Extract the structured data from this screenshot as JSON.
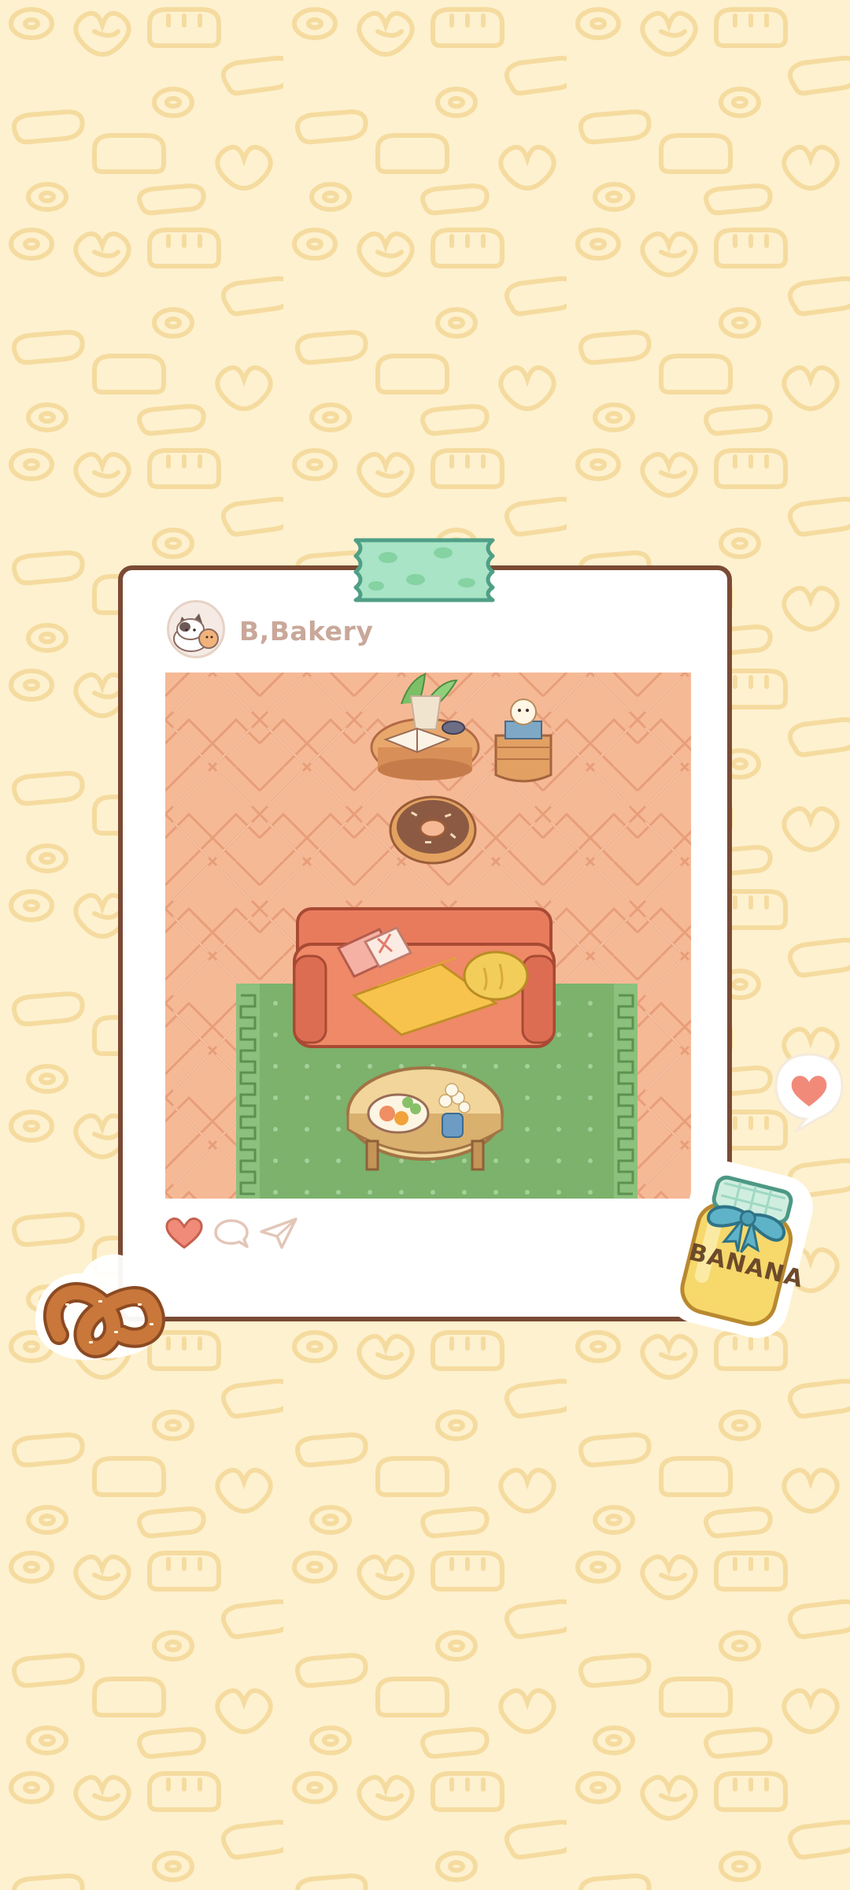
{
  "post": {
    "username": "B,Bakery",
    "actions": {
      "like": "heart-icon",
      "comment": "comment-icon",
      "share": "send-icon"
    }
  },
  "stickers": {
    "jar_label": "BANANA",
    "pretzel": "pretzel-sticker",
    "bubble": "heart-bubble"
  },
  "colors": {
    "background": "#fdf1cf",
    "pattern": "#f6dea0",
    "card_border": "#7a4a34",
    "floor": "#f5b896",
    "rug": "#78ad69",
    "tape": "#a8e4c5",
    "like": "#f08b7a",
    "sofa": "#e9805f"
  }
}
